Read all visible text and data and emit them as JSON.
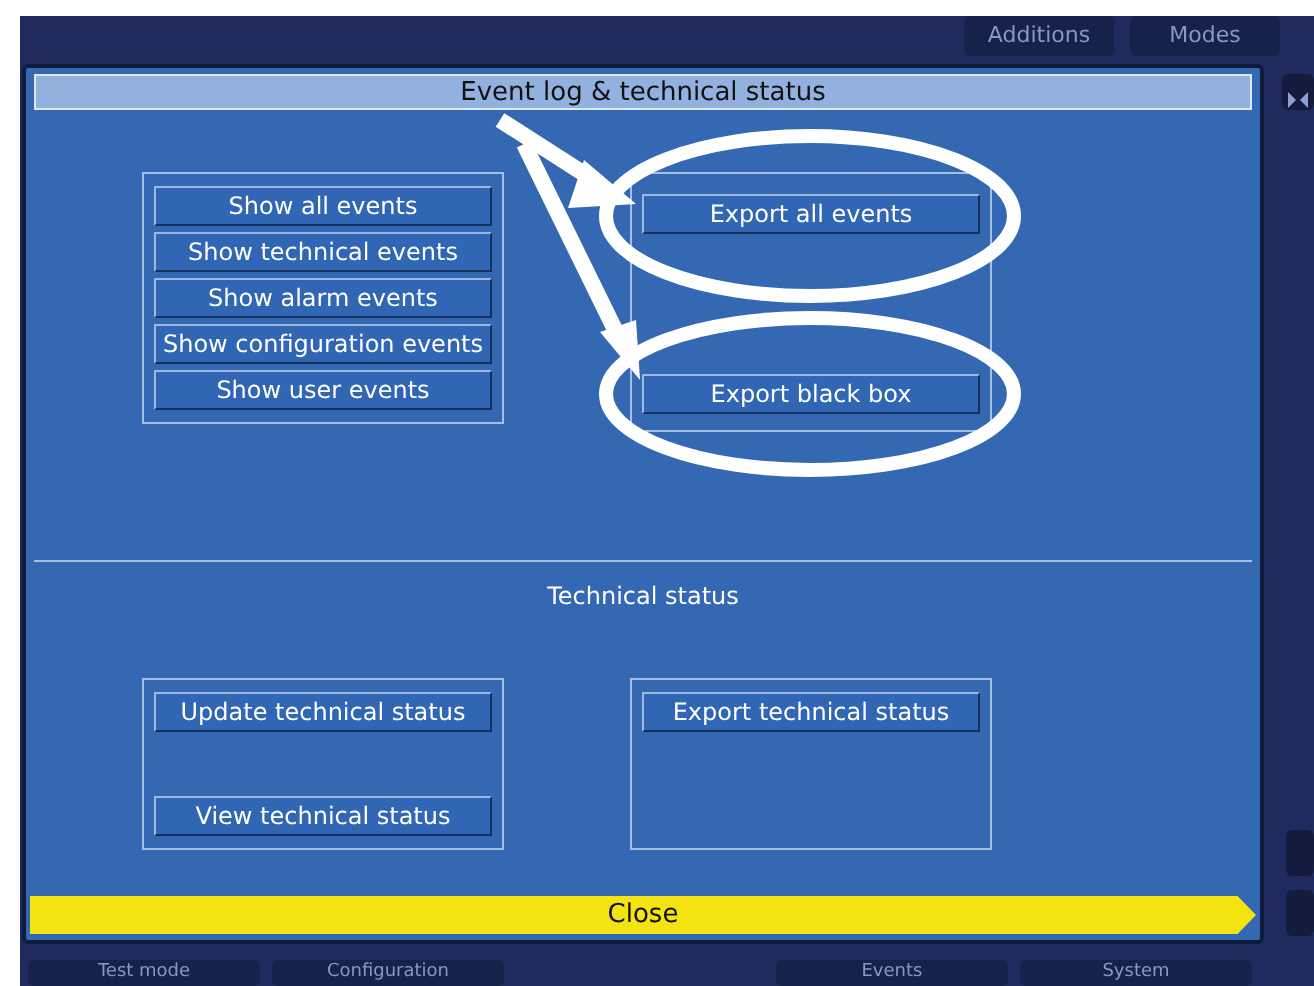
{
  "background_buttons_top": [
    "Additions",
    "Modes"
  ],
  "dialog": {
    "title": "Event log & technical status",
    "event_buttons": [
      "Show all events",
      "Show technical events",
      "Show alarm events",
      "Show configuration events",
      "Show user events"
    ],
    "export_buttons": [
      "Export all events",
      "Export black box"
    ],
    "section_title": "Technical status",
    "status_buttons": [
      "Update technical status",
      "View technical status"
    ],
    "status_export_buttons": [
      "Export technical status"
    ],
    "close_button": "Close"
  },
  "background_buttons_bottom": [
    "Test mode",
    "Configuration",
    "Events",
    "System"
  ]
}
